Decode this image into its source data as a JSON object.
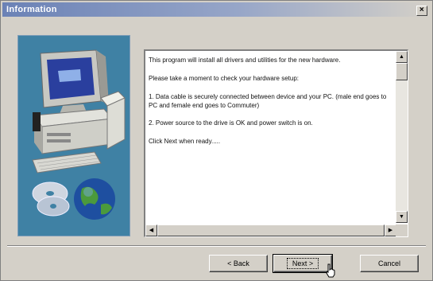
{
  "window": {
    "title": "Information",
    "close_glyph": "×"
  },
  "illustration": {
    "alt": "computer and CD illustration",
    "colors": {
      "panel": "#3f81a4",
      "screen": "#2a3f9e"
    }
  },
  "info_text": {
    "paragraphs": [
      "This program will install all drivers and utilities for the new hardware.",
      "Please take a moment to check your hardware setup:",
      "1. Data cable is securely connected between device and your PC. (male end goes to PC and female end goes to Commuter)",
      "2. Power source to the drive is OK and power switch is on.",
      "Click Next when ready....."
    ]
  },
  "scroll": {
    "up": "▲",
    "down": "▼",
    "left": "◀",
    "right": "▶"
  },
  "buttons": {
    "back": "< Back",
    "next": "Next >",
    "cancel": "Cancel"
  }
}
